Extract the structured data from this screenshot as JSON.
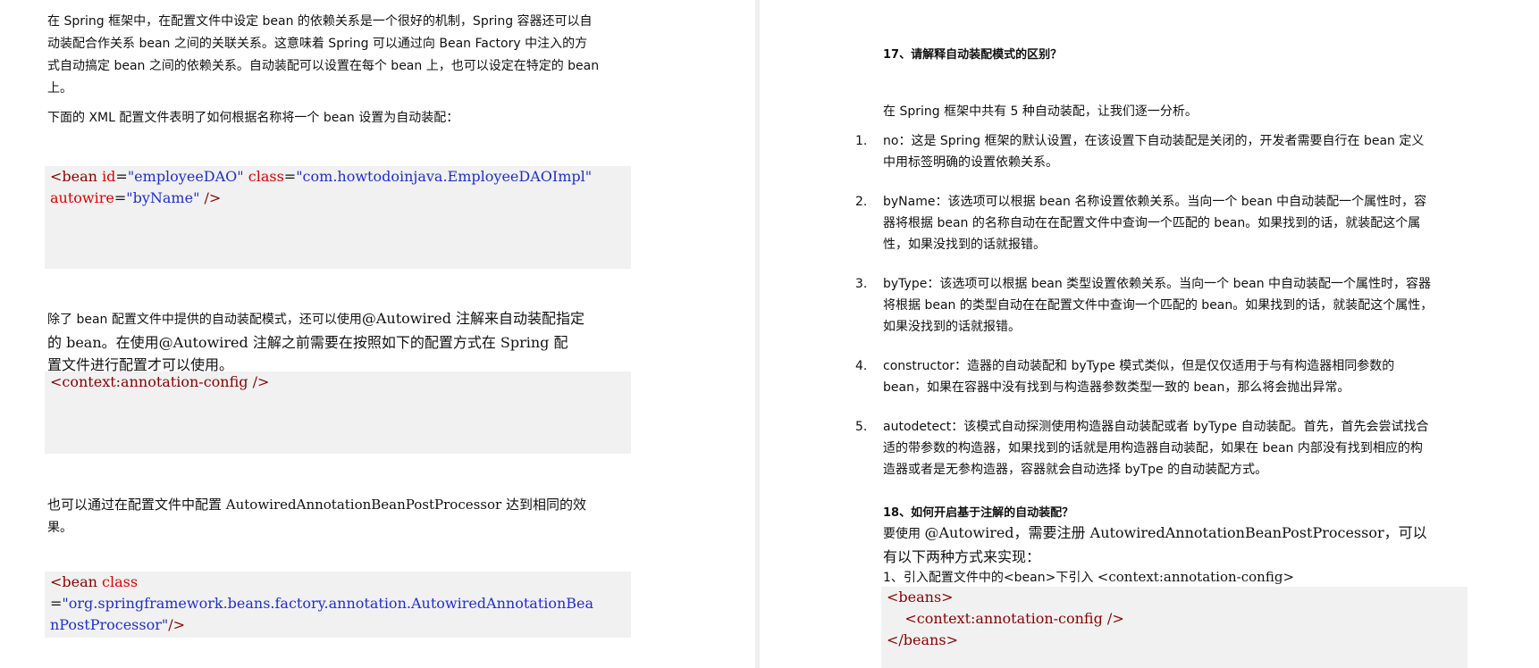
{
  "left": {
    "p1_lines": [
      "在 Spring 框架中，在配置文件中设定 bean 的依赖关系是一个很好的机制，Spring 容器还可以自",
      "动装配合作关系 bean 之间的关联关系。这意味着 Spring 可以通过向 Bean Factory 中注入的方",
      "式自动搞定 bean 之间的依赖关系。自动装配可以设置在每个 bean 上，也可以设定在特定的 bean",
      "上。"
    ],
    "p2": "下面的 XML 配置文件表明了如何根据名称将一个 bean 设置为自动装配：",
    "code1": {
      "line1": {
        "tag_open": "<bean ",
        "attr1": "id",
        "eq1": "=",
        "val1": "\"employeeDAO\" ",
        "attr2": "class",
        "eq2": "=",
        "val2": "\"com.howtodoinjava.EmployeeDAOImpl\""
      },
      "line2": {
        "attr3": "autowire",
        "eq3": "=",
        "val3": "\"byName\"",
        "close": " />"
      }
    },
    "p3": {
      "a": "除了 bean 配置文件中提供的自动装配模式，还可以使用",
      "b": "@Autowired 注解来自动装配指定",
      "line2": "的 bean。在使用@Autowired 注解之前需要在按照如下的配置方式在 Spring 配",
      "line3": "置文件进行配置才可以使用。"
    },
    "code2": "<context:annotation-config />",
    "p4_lines": [
      "也可以通过在配置文件中配置 AutowiredAnnotationBeanPostProcessor 达到相同的效",
      "果。"
    ],
    "code3": {
      "tag": "<bean ",
      "attr": "class",
      "eq": "=",
      "val_line1": "\"org.springframework.beans.factory.annotation.AutowiredAnnotationBea",
      "val_line2": "nPostProcessor\"",
      "close": "/>"
    }
  },
  "right": {
    "q17": "17、请解释自动装配模式的区别？",
    "intro": "在 Spring 框架中共有 5 种自动装配，让我们逐一分析。",
    "items": [
      {
        "num": "1.",
        "lines": [
          "no：这是 Spring 框架的默认设置，在该设置下自动装配是关闭的，开发者需要自行在 bean 定义",
          "中用标签明确的设置依赖关系。"
        ]
      },
      {
        "num": "2.",
        "lines": [
          "byName：该选项可以根据 bean 名称设置依赖关系。当向一个 bean 中自动装配一个属性时，容",
          "器将根据 bean 的名称自动在在配置文件中查询一个匹配的 bean。如果找到的话，就装配这个属",
          "性，如果没找到的话就报错。"
        ]
      },
      {
        "num": "3.",
        "lines": [
          "byType：该选项可以根据 bean 类型设置依赖关系。当向一个 bean 中自动装配一个属性时，容器",
          "将根据 bean 的类型自动在在配置文件中查询一个匹配的 bean。如果找到的话，就装配这个属性，",
          "如果没找到的话就报错。"
        ]
      },
      {
        "num": "4.",
        "lines": [
          "constructor：造器的自动装配和 byType 模式类似，但是仅仅适用于与有构造器相同参数的",
          "bean，如果在容器中没有找到与构造器参数类型一致的 bean，那么将会抛出异常。"
        ]
      },
      {
        "num": "5.",
        "lines": [
          "autodetect：该模式自动探测使用构造器自动装配或者 byType 自动装配。首先，首先会尝试找合",
          "适的带参数的构造器，如果找到的话就是用构造器自动装配，如果在 bean 内部没有找到相应的构",
          "造器或者是无参构造器，容器就会自动选择 byTpe 的自动装配方式。"
        ]
      }
    ],
    "q18": "18、如何开启基于注解的自动装配？",
    "p18": {
      "a": "要使用 ",
      "b": "@Autowired，需要注册 AutowiredAnnotationBeanPostProcessor，可以",
      "line2": "有以下两种方式来实现："
    },
    "step1": {
      "a": "1、引入配置文件中的<bean>下引入 ",
      "b": "<context:annotation-config>"
    },
    "code4": [
      "<beans>",
      "    <context:annotation-config />",
      "</beans>"
    ]
  },
  "colors": {
    "tag": "#8b0000",
    "attr": "#e00000",
    "value": "#1f2fd0",
    "code_bg": "#f1f1f1"
  }
}
